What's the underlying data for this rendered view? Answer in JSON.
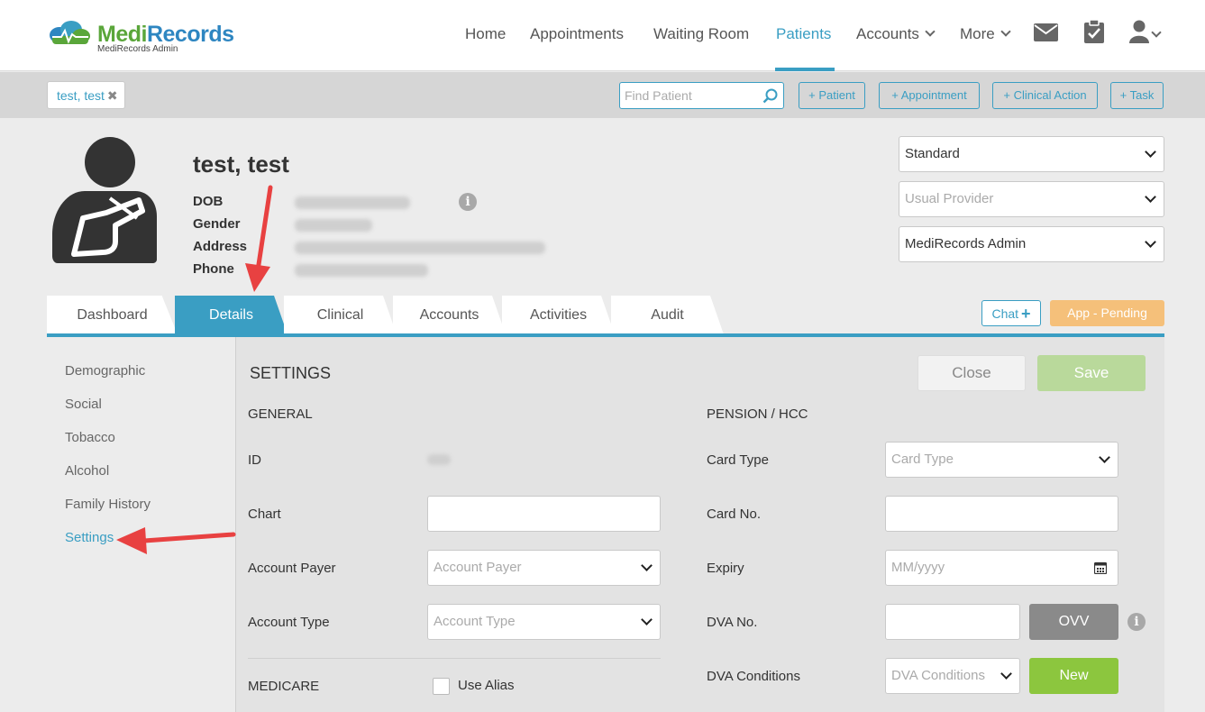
{
  "logo": {
    "text_part1": "Medi",
    "text_part2": "Records",
    "subtitle": "MediRecords Admin"
  },
  "nav": {
    "home": "Home",
    "appointments": "Appointments",
    "waiting_room": "Waiting Room",
    "patients": "Patients",
    "accounts": "Accounts",
    "more": "More",
    "icons": [
      "mail-icon",
      "clipboard-check-icon",
      "user-icon"
    ]
  },
  "toolbar": {
    "patient_chip": "test, test",
    "find_placeholder": "Find Patient",
    "add_patient": "+ Patient",
    "add_appointment": "+ Appointment",
    "add_clinical_action": "+ Clinical Action",
    "add_task": "+ Task"
  },
  "patient": {
    "name": "test, test",
    "labels": {
      "dob": "DOB",
      "gender": "Gender",
      "address": "Address",
      "phone": "Phone"
    }
  },
  "selects": {
    "type": "Standard",
    "usual_provider": "Usual Provider",
    "practice": "MediRecords Admin"
  },
  "tabs": {
    "dashboard": "Dashboard",
    "details": "Details",
    "clinical": "Clinical",
    "accounts": "Accounts",
    "activities": "Activities",
    "audit": "Audit",
    "active": "Details"
  },
  "actions": {
    "chat": "Chat",
    "app_pending": "App - Pending"
  },
  "sidenav": {
    "items": [
      "Demographic",
      "Social",
      "Tobacco",
      "Alcohol",
      "Family History",
      "Settings"
    ],
    "active": "Settings"
  },
  "settings": {
    "title": "SETTINGS",
    "close": "Close",
    "save": "Save",
    "general": {
      "heading": "GENERAL",
      "id_label": "ID",
      "chart_label": "Chart",
      "account_payer_label": "Account Payer",
      "account_payer_placeholder": "Account Payer",
      "account_type_label": "Account Type",
      "account_type_placeholder": "Account Type"
    },
    "medicare": {
      "heading": "MEDICARE",
      "use_alias": "Use Alias"
    },
    "pension": {
      "heading": "PENSION / HCC",
      "card_type_label": "Card Type",
      "card_type_placeholder": "Card Type",
      "card_no_label": "Card No.",
      "expiry_label": "Expiry",
      "expiry_placeholder": "MM/yyyy",
      "dva_no_label": "DVA No.",
      "ovv": "OVV",
      "dva_conditions_label": "DVA Conditions",
      "dva_conditions_placeholder": "DVA Conditions",
      "new": "New"
    }
  },
  "colors": {
    "accent": "#3a9ec3",
    "save": "#b9d99b",
    "new": "#8cc63e",
    "pending": "#f5c07a",
    "arrow": "#e84141"
  }
}
